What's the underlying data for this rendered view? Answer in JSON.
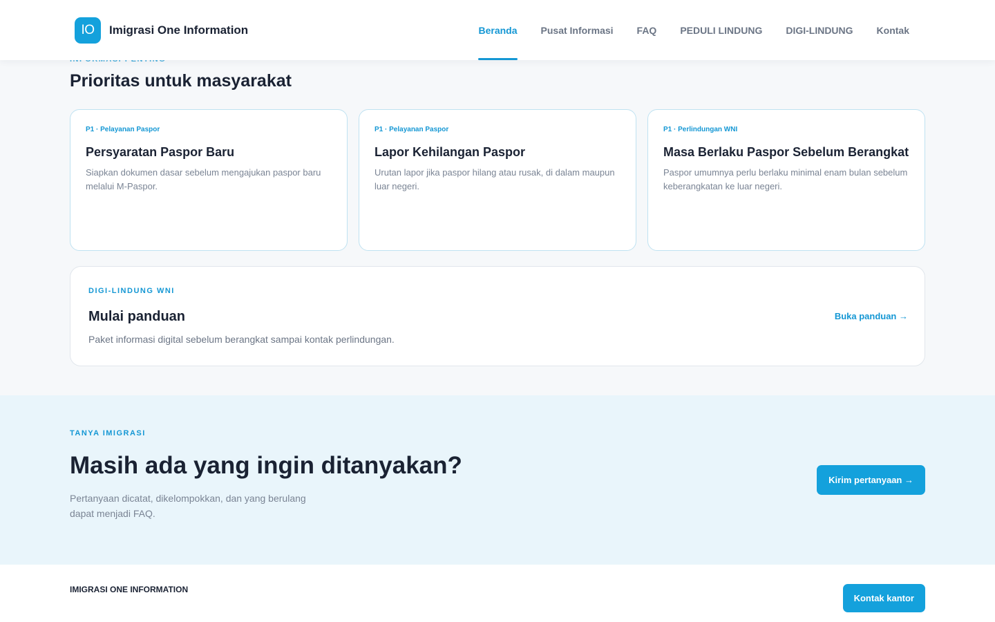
{
  "header": {
    "logo_text": "IO",
    "brand_name": "Imigrasi One Information",
    "nav": [
      {
        "label": "Beranda",
        "active": true
      },
      {
        "label": "Pusat Informasi",
        "active": false
      },
      {
        "label": "FAQ",
        "active": false
      },
      {
        "label": "PEDULI LINDUNG",
        "active": false
      },
      {
        "label": "DIGI-LINDUNG",
        "active": false
      },
      {
        "label": "Kontak",
        "active": false
      }
    ]
  },
  "priority": {
    "eyebrow": "INFORMASI PENTING",
    "title": "Prioritas untuk masyarakat",
    "cards": [
      {
        "tag": "P1 · Pelayanan Paspor",
        "title": "Persyaratan Paspor Baru",
        "desc": "Siapkan dokumen dasar sebelum mengajukan paspor baru melalui M-Paspor."
      },
      {
        "tag": "P1 · Pelayanan Paspor",
        "title": "Lapor Kehilangan Paspor",
        "desc": "Urutan lapor jika paspor hilang atau rusak, di dalam maupun luar negeri."
      },
      {
        "tag": "P1 · Perlindungan WNI",
        "title": "Masa Berlaku Paspor Sebelum Berangkat",
        "desc": "Paspor umumnya perlu berlaku minimal enam bulan sebelum keberangkatan ke luar negeri."
      }
    ]
  },
  "digi": {
    "tag": "DIGI-LINDUNG WNI",
    "title": "Mulai panduan",
    "desc": "Paket informasi digital sebelum berangkat sampai kontak perlindungan.",
    "link": "Buka panduan →"
  },
  "tanya": {
    "tag": "TANYA IMIGRASI",
    "title": "Masih ada yang ingin ditanyakan?",
    "desc": "Pertanyaan dicatat, dikelompokkan, dan yang berulang dapat menjadi FAQ.",
    "button": "Kirim pertanyaan →"
  },
  "footer": {
    "brand": "IMIGRASI ONE INFORMATION",
    "button": "Kontak kantor"
  },
  "colors": {
    "accent": "#14a1dc",
    "text_dark": "#1a2233",
    "text_muted": "#7a8494",
    "tanya_bg": "#e9f5fb"
  }
}
